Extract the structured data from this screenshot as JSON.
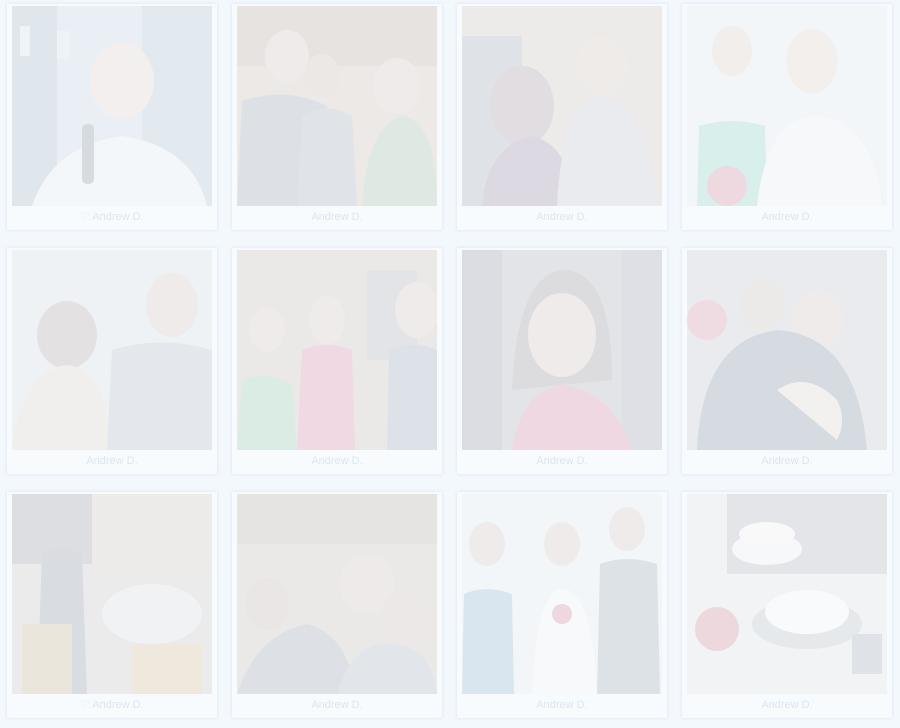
{
  "gallery": {
    "photos": [
      {
        "author": "Andrew D.",
        "favorite_icon": "♡"
      },
      {
        "author": "Andrew D.",
        "favorite_icon": ""
      },
      {
        "author": "Andrew D.",
        "favorite_icon": ""
      },
      {
        "author": "Andrew D.",
        "favorite_icon": ""
      },
      {
        "author": "Andrew D.",
        "favorite_icon": ""
      },
      {
        "author": "Andrew D.",
        "favorite_icon": ""
      },
      {
        "author": "Andrew D.",
        "favorite_icon": ""
      },
      {
        "author": "Andrew D.",
        "favorite_icon": ""
      },
      {
        "author": "Andrew D.",
        "favorite_icon": "♡"
      },
      {
        "author": "Andrew D.",
        "favorite_icon": ""
      },
      {
        "author": "Andrew D.",
        "favorite_icon": ""
      },
      {
        "author": "Andrew D.",
        "favorite_icon": ""
      }
    ]
  }
}
